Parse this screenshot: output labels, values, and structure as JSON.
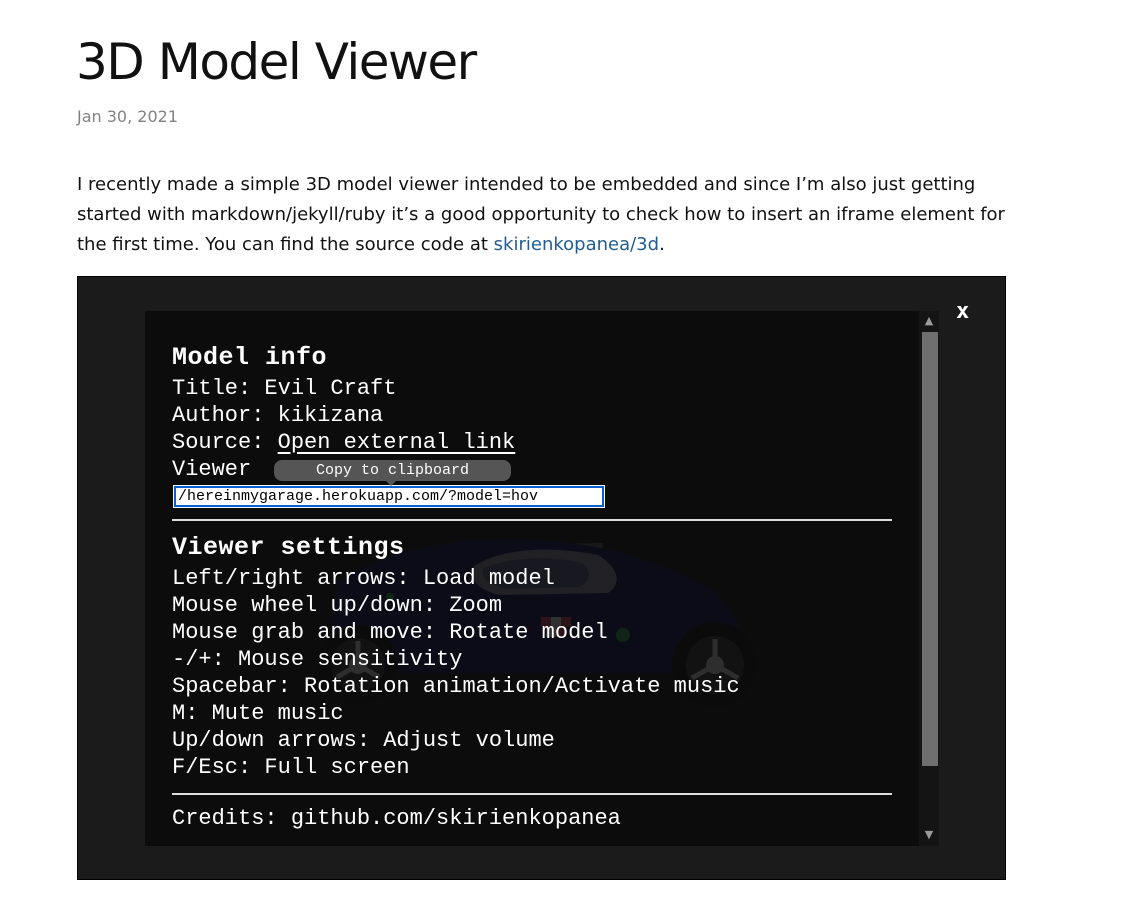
{
  "post": {
    "title": "3D Model Viewer",
    "date": "Jan 30, 2021",
    "body_line1": "I recently made a simple 3D model viewer intended to be embedded and since I’m also just getting",
    "body_line2": "started with markdown/jekyll/ruby it’s a good opportunity to check how to insert an iframe element for",
    "body_line3_prefix": "the first time. You can find the source code at ",
    "body_link": "skirienkopanea/3d",
    "body_line3_suffix": "."
  },
  "viewer": {
    "close_label": "x",
    "model_info": {
      "heading": "Model info",
      "title_label": "Title: ",
      "title_value": "Evil Craft",
      "author_label": "Author: ",
      "author_value": "kikizana",
      "source_label": "Source: ",
      "source_link": "Open external link",
      "viewer_label": "Viewer",
      "tooltip": "Copy to clipboard",
      "url_value": "/hereinmygarage.herokuapp.com/?model=hov"
    },
    "settings": {
      "heading": "Viewer settings",
      "items": [
        "Left/right arrows: Load model",
        "Mouse wheel up/down: Zoom",
        "Mouse grab and move: Rotate model",
        "-/+: Mouse sensitivity",
        "Spacebar: Rotation animation/Activate music",
        "M: Mute music",
        "Up/down arrows: Adjust volume",
        "F/Esc: Full screen"
      ]
    },
    "credits": "Credits: github.com/skirienkopanea",
    "scroll_up": "▲",
    "scroll_down": "▼"
  }
}
